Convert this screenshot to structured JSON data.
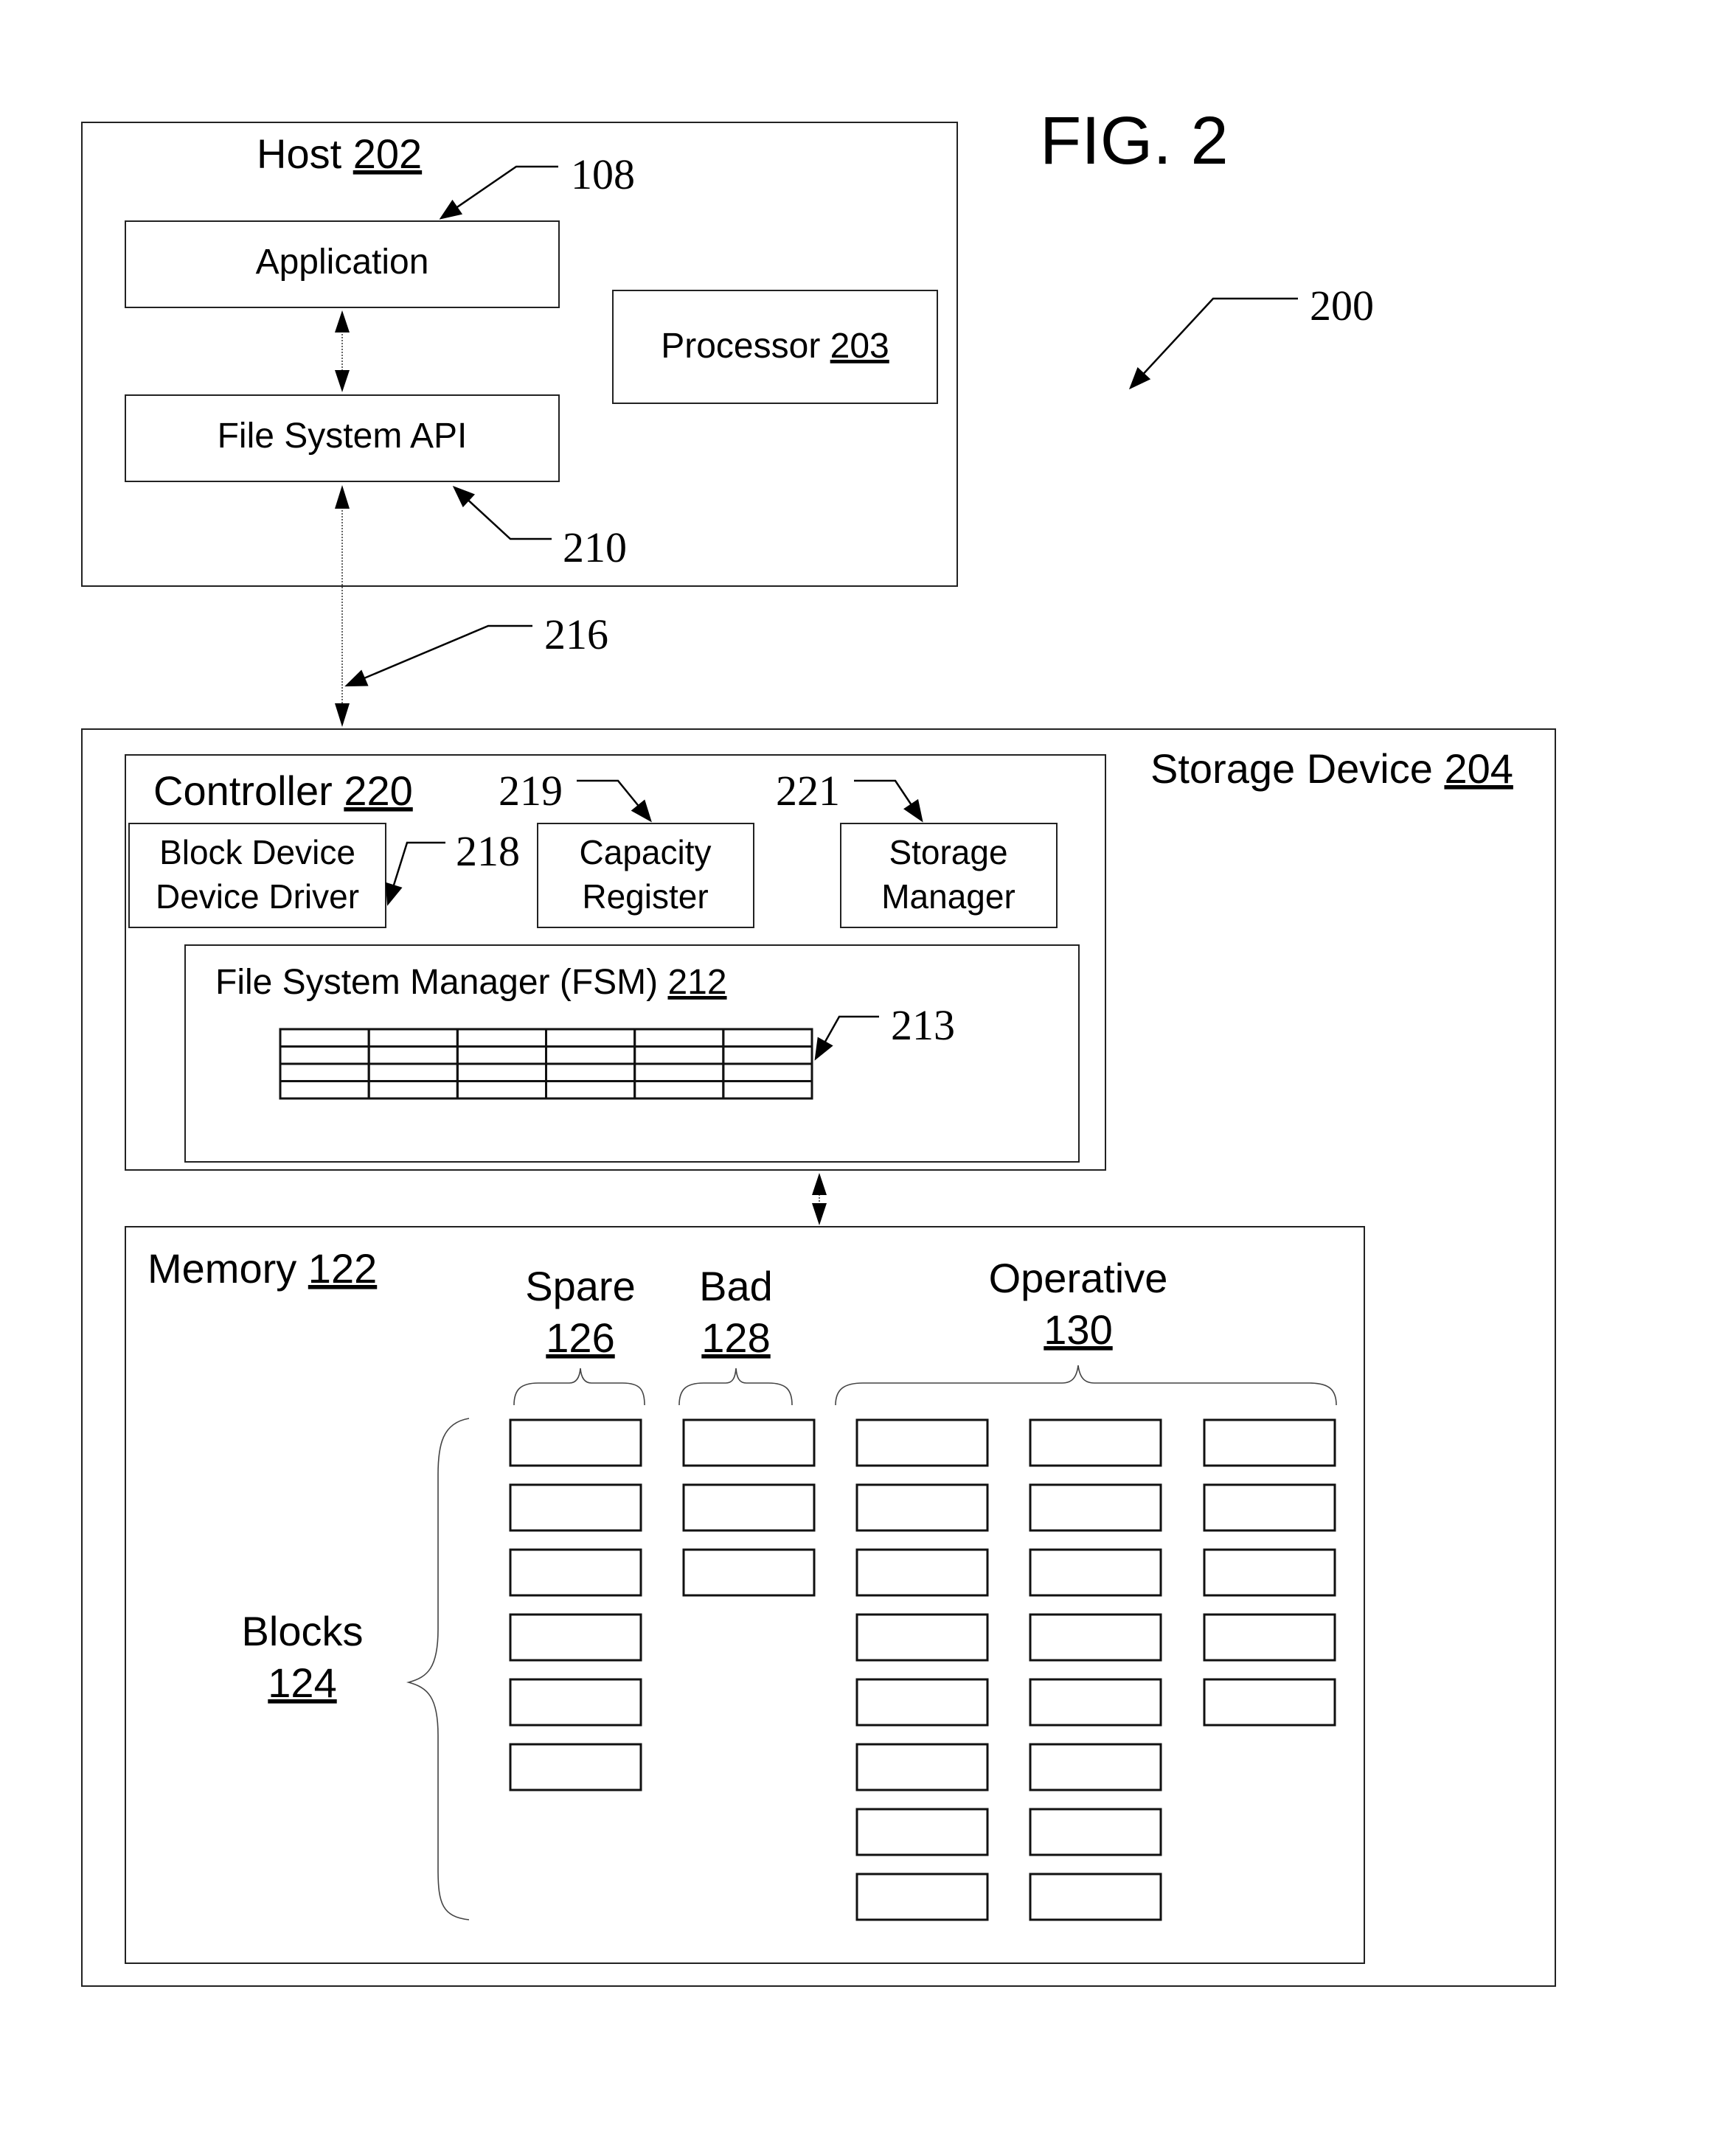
{
  "figure": {
    "title": "FIG. 2",
    "ref_overall": "200"
  },
  "host": {
    "label": "Host",
    "ref": "202",
    "application": {
      "label": "Application",
      "ref_pointer": "108"
    },
    "fs_api": {
      "label": "File System API",
      "ref_pointer": "210"
    },
    "processor": {
      "label": "Processor",
      "ref": "203"
    }
  },
  "link": {
    "ref_pointer": "216"
  },
  "storage": {
    "label": "Storage Device",
    "ref": "204",
    "controller": {
      "label": "Controller",
      "ref": "220",
      "block_driver": {
        "line1": "Block Device",
        "line2": "Device Driver",
        "ref_pointer": "218"
      },
      "capacity_register": {
        "line1": "Capacity",
        "line2": "Register",
        "ref_pointer": "219"
      },
      "storage_manager": {
        "line1": "Storage",
        "line2": "Manager",
        "ref_pointer": "221"
      },
      "fsm": {
        "label": "File System Manager (FSM)",
        "ref": "212",
        "table_ref_pointer": "213",
        "table_rows": 4,
        "table_cols": 6
      }
    },
    "memory": {
      "label": "Memory",
      "ref": "122",
      "blocks_label": "Blocks",
      "blocks_ref": "124",
      "groups": [
        {
          "label": "Spare",
          "ref": "126",
          "columns": [
            6
          ]
        },
        {
          "label": "Bad",
          "ref": "128",
          "columns": [
            3
          ]
        },
        {
          "label": "Operative",
          "ref": "130",
          "columns": [
            8,
            8,
            5
          ]
        }
      ]
    }
  }
}
